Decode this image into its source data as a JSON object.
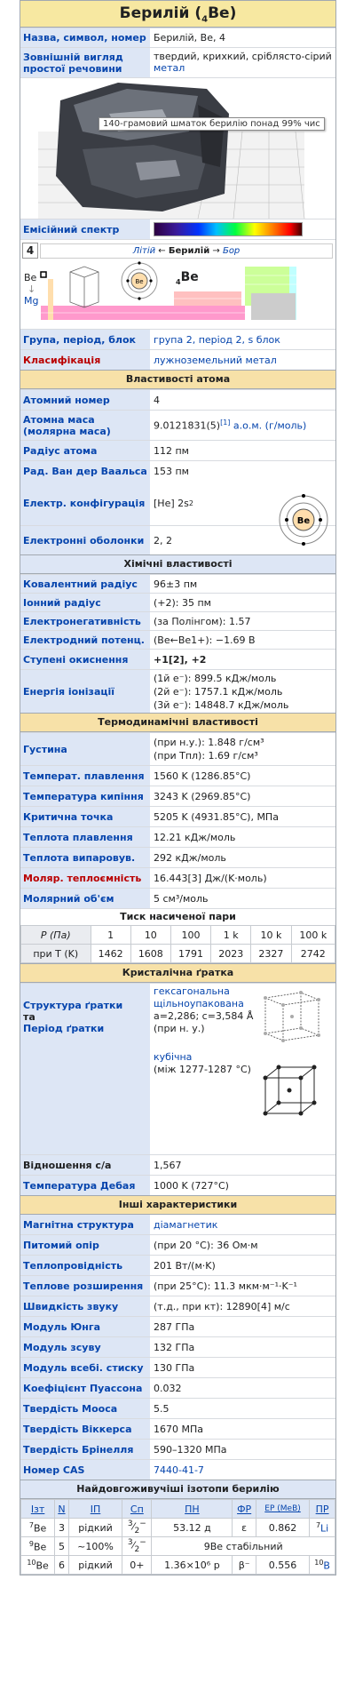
{
  "title": {
    "name": "Берилій (",
    "sub": "4",
    "sym": "Be)"
  },
  "basic": [
    {
      "k": "Назва, символ, номер",
      "v": "Берилій, Be, 4"
    },
    {
      "k": "Зовнішній вигляд простої речовини",
      "v": "твердий, крихкий, сріблясто-сірий ",
      "v2": "метал"
    }
  ],
  "image_caption": "140-грамовий шматок берилію понад 99% чис",
  "spectrum_label": "Емісійний спектр",
  "pt": {
    "group": "4",
    "left": "Літій",
    "center": "Берилій",
    "right": "Бор",
    "above": "Be",
    "below": "Mg",
    "symbol_num": "4",
    "symbol": "Be",
    "atom_label": "Be"
  },
  "classif": [
    {
      "k": "Група, період, блок",
      "v": "група 2, період 2, s блок"
    },
    {
      "k": "Класифікація",
      "v": "лужноземельний метал"
    }
  ],
  "sections": {
    "atom": "Властивості атома",
    "chem": "Хімічні властивості",
    "thermo": "Термодинамічні властивості",
    "vapor": "Тиск насиченої пари",
    "crystal": "Кристалічна ґратка",
    "other": "Інші характеристики",
    "isotopes": "Найдовгоживучіші ізотопи берилію"
  },
  "atom": [
    {
      "k": "Атомний номер",
      "v": "4"
    },
    {
      "k": "Атомна маса (молярна маса)",
      "v": "9.0121831(5)",
      "ref": "[1]",
      "unit": " а.о.м. (г/моль)"
    },
    {
      "k": "Радіус атома",
      "v": "112 пм"
    },
    {
      "k": "Рад. Ван дер Ваальса",
      "v": "153 пм"
    },
    {
      "k": "Електр. конфігурація",
      "v": "[He] 2s",
      "sup": "2"
    },
    {
      "k": "Електронні оболонки",
      "v": "2, 2"
    }
  ],
  "chem": [
    {
      "k": "Ковалентний радіус",
      "v": "96±3 пм"
    },
    {
      "k": "Іонний радіус",
      "v": "(+2): 35 пм"
    },
    {
      "k": "Електронегативність",
      "v": "(за Полінгом): 1.57"
    },
    {
      "k": "Електродний потенц.",
      "v": "(Be←Be1+): −1.69 В"
    },
    {
      "k": "Ступені окиснення",
      "v": "+1[2], +2"
    },
    {
      "k": "Енергія іонізації",
      "v": "(1й е⁻): 899.5 кДж/моль",
      "v2": "(2й е⁻): 1757.1 кДж/моль",
      "v3": "(3й е⁻): 14848.7 кДж/моль"
    }
  ],
  "thermo": [
    {
      "k": "Густина",
      "v": "(при н.у.): 1.848 г/см³",
      "v2": "(при Tпл): 1.69 г/см³"
    },
    {
      "k": "Температ. плавлення",
      "v": "1560 K (1286.85°C)"
    },
    {
      "k": "Температура кипіння",
      "v": "3243 K (2969.85°C)"
    },
    {
      "k": "Критична точка",
      "v": "5205 K (4931.85°C),    МПа"
    },
    {
      "k": "Теплота плавлення",
      "v": "12.21 кДж/моль"
    },
    {
      "k": "Теплота випаровув.",
      "v": "292 кДж/моль"
    },
    {
      "k": "Моляр. теплоємність",
      "v": "16.443[3] Дж/(K·моль)"
    },
    {
      "k": "Молярний об'єм",
      "v": "5 см³/моль"
    }
  ],
  "vapor": {
    "row1_label": "P (Па)",
    "pressures": [
      "1",
      "10",
      "100",
      "1 k",
      "10 k",
      "100 k"
    ],
    "row2_label": "при T (K)",
    "temps": [
      "1462",
      "1608",
      "1791",
      "2023",
      "2327",
      "2742"
    ]
  },
  "crystal": {
    "k1": "Структура ґратки",
    "k_and": "та",
    "k2": "Період ґратки",
    "v_lines": [
      "гексагональна",
      "щільноупакована",
      "a=2,286; c=3,584 Å",
      "(при н. у.)"
    ],
    "v2_lines": [
      "кубічна",
      "(між 1277-1287 °C)"
    ],
    "ratio_k": "Відношення c/a",
    "ratio_v": "1,567",
    "debye_k": "Температура Дебая",
    "debye_v": "1000 K (727°C)"
  },
  "other": [
    {
      "k": "Магнітна структура",
      "v": "діамагнетик"
    },
    {
      "k": "Питомий опір",
      "v": "(при 20 °C): 36 Ом·м"
    },
    {
      "k": "Теплопровідність",
      "v": "201 Вт/(м·K)"
    },
    {
      "k": "Теплове розширення",
      "v": "(при 25°C): 11.3 мкм·м⁻¹·K⁻¹"
    },
    {
      "k": "Швидкість звуку",
      "v": "(т.д., при кт): 12890[4] м/с"
    },
    {
      "k": "Модуль Юнга",
      "v": "287 ГПа"
    },
    {
      "k": "Модуль зсуву",
      "v": "132 ГПа"
    },
    {
      "k": "Модуль всебі. стиску",
      "v": "130 ГПа"
    },
    {
      "k": "Коефіцієнт Пуассона",
      "v": "0.032"
    },
    {
      "k": "Твердість Мооса",
      "v": "5.5"
    },
    {
      "k": "Твердість Віккерса",
      "v": "1670 МПа"
    },
    {
      "k": "Твердість Брінелля",
      "v": "590–1320 МПа"
    },
    {
      "k": "Номер CAS",
      "v": "7440-41-7"
    }
  ],
  "isotopes": {
    "headers": [
      "Ізт",
      "N",
      "ІП",
      "Сп",
      "ПН",
      "ФР",
      "ЕР (МеВ)",
      "ПР"
    ],
    "rows": [
      {
        "iso_a": "7",
        "iso_s": "Be",
        "n": "3",
        "ip": "рідкий",
        "sp_a": "3",
        "sp_b": "2",
        "sp_sign": "−",
        "pn": "53.12 д",
        "fr": "ε",
        "er": "0.862",
        "pr_a": "7",
        "pr_s": "Li"
      },
      {
        "iso_a": "9",
        "iso_s": "Be",
        "n": "5",
        "ip": "~100%",
        "sp_a": "3",
        "sp_b": "2",
        "sp_sign": "−",
        "stable": "9Be стабільний"
      },
      {
        "iso_a": "10",
        "iso_s": "Be",
        "n": "6",
        "ip": "рідкий",
        "sp": "0+",
        "pn": "1.36×10⁶ р",
        "fr": "β⁻",
        "er": "0.556",
        "pr_a": "10",
        "pr_s": "B"
      }
    ]
  },
  "colors": {
    "title_bg": "#f7e8a1",
    "label_bg": "#dde6f5",
    "link": "#0645ad",
    "alkaline_earth": "#ffdead"
  }
}
